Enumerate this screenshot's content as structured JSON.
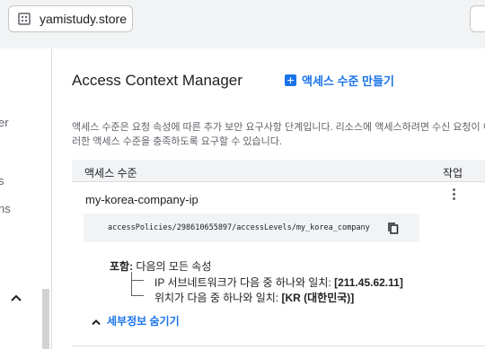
{
  "browser": {
    "url": "yamistudy.store",
    "url_icon": "site-info-icon"
  },
  "sidebar": {
    "fragments": [
      "er",
      "s",
      "ns"
    ],
    "collapse_icon": "chevron-up-icon"
  },
  "page": {
    "title": "Access Context Manager",
    "create_button": "액세스 수준 만들기",
    "description": "액세스 수준은 요청 속성에 따른 추가 보안 요구사항 단계입니다. 리소스에 액세스하려면 수신 요청이 이러한 액세스 수준을 충족하도록 요구할 수 있습니다."
  },
  "table": {
    "headers": {
      "level": "액세스 수준",
      "action": "작업"
    },
    "rows": [
      {
        "name": "my-korea-company-ip",
        "resource_path": "accessPolicies/298610655897/accessLevels/my_korea_company",
        "includes_label": "포함:",
        "includes_text": "다음의 모든 속성",
        "conditions": [
          {
            "prefix": "IP 서브네트워크가 다음 중 하나와 일치:",
            "value": "[211.45.62.11]"
          },
          {
            "prefix": "위치가 다음 중 하나와 일치:",
            "value": "[KR (대한민국)]"
          }
        ],
        "toggle_details": "세부정보 숨기기"
      }
    ]
  },
  "colors": {
    "accent": "#1a73e8",
    "header_bg": "#f1f3f4",
    "text": "#202124",
    "muted": "#5f6368"
  }
}
